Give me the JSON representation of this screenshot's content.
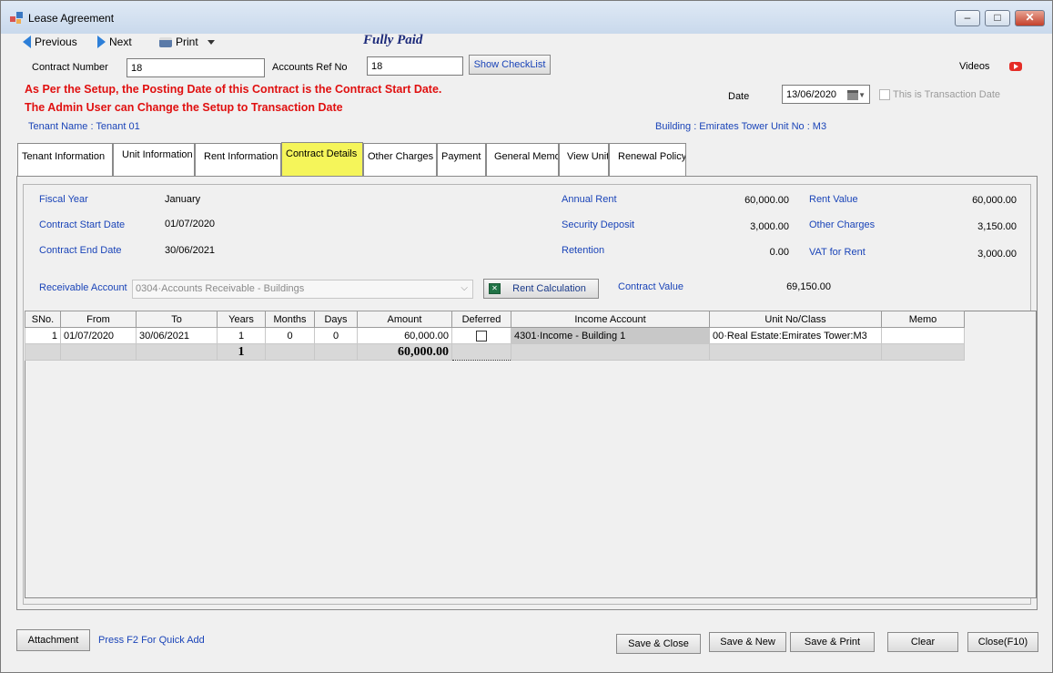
{
  "window": {
    "title": "Lease Agreement",
    "min": "–",
    "max": "□",
    "close": "✕"
  },
  "toolbar": {
    "previous": "Previous",
    "next": "Next",
    "print": "Print"
  },
  "status": "Fully Paid",
  "header": {
    "contract_number_label": "Contract Number",
    "contract_number_value": "18",
    "accounts_ref_label": "Accounts Ref No",
    "accounts_ref_value": "18",
    "show_checklist": "Show CheckList",
    "videos": "Videos",
    "warning1": "As Per the Setup, the Posting Date of this Contract is the Contract Start Date.",
    "warning2": "The Admin User can Change the Setup to Transaction Date",
    "date_label": "Date",
    "date_value": "13/06/2020",
    "transaction_date_label": "This is Transaction Date",
    "tenant": "Tenant Name : Tenant 01",
    "building": "Building : Emirates Tower  Unit No : M3"
  },
  "tabs": [
    {
      "label": "Tenant Information"
    },
    {
      "label": "Unit Information"
    },
    {
      "label": "Rent Information"
    },
    {
      "label": "Contract Details"
    },
    {
      "label": "Other Charges"
    },
    {
      "label": "Payment"
    },
    {
      "label": "General Memo"
    },
    {
      "label": "View Unit"
    },
    {
      "label": "Renewal Policy"
    }
  ],
  "details": {
    "fiscal_year_label": "Fiscal Year",
    "fiscal_year": "January",
    "start_label": "Contract Start Date",
    "start": "01/07/2020",
    "end_label": "Contract End Date",
    "end": "30/06/2021",
    "annual_rent_label": "Annual Rent",
    "annual_rent": "60,000.00",
    "security_label": "Security Deposit",
    "security": "3,000.00",
    "retention_label": "Retention",
    "retention": "0.00",
    "rent_value_label": "Rent Value",
    "rent_value": "60,000.00",
    "other_charges_label": "Other Charges",
    "other_charges": "3,150.00",
    "vat_label": "VAT for Rent",
    "vat": "3,000.00",
    "receivable_label": "Receivable Account",
    "receivable": "0304·Accounts Receivable - Buildings",
    "rent_calc": "Rent Calculation",
    "contract_value_label": "Contract Value",
    "contract_value": "69,150.00"
  },
  "grid": {
    "headers": [
      "SNo.",
      "From",
      "To",
      "Years",
      "Months",
      "Days",
      "Amount",
      "Deferred",
      "Income Account",
      "Unit No/Class",
      "Memo"
    ],
    "row": {
      "sno": "1",
      "from": "01/07/2020",
      "to": "30/06/2021",
      "years": "1",
      "months": "0",
      "days": "0",
      "amount": "60,000.00",
      "income": "4301·Income - Building 1",
      "unit": "00·Real Estate:Emirates Tower:M3",
      "memo": ""
    },
    "totals": {
      "years": "1",
      "amount": "60,000.00"
    }
  },
  "footer": {
    "attachment": "Attachment",
    "hint": "Press F2 For Quick Add",
    "save_close": "Save & Close",
    "save_new": "Save & New",
    "save_print": "Save & Print",
    "clear": "Clear",
    "close": "Close(F10)"
  }
}
